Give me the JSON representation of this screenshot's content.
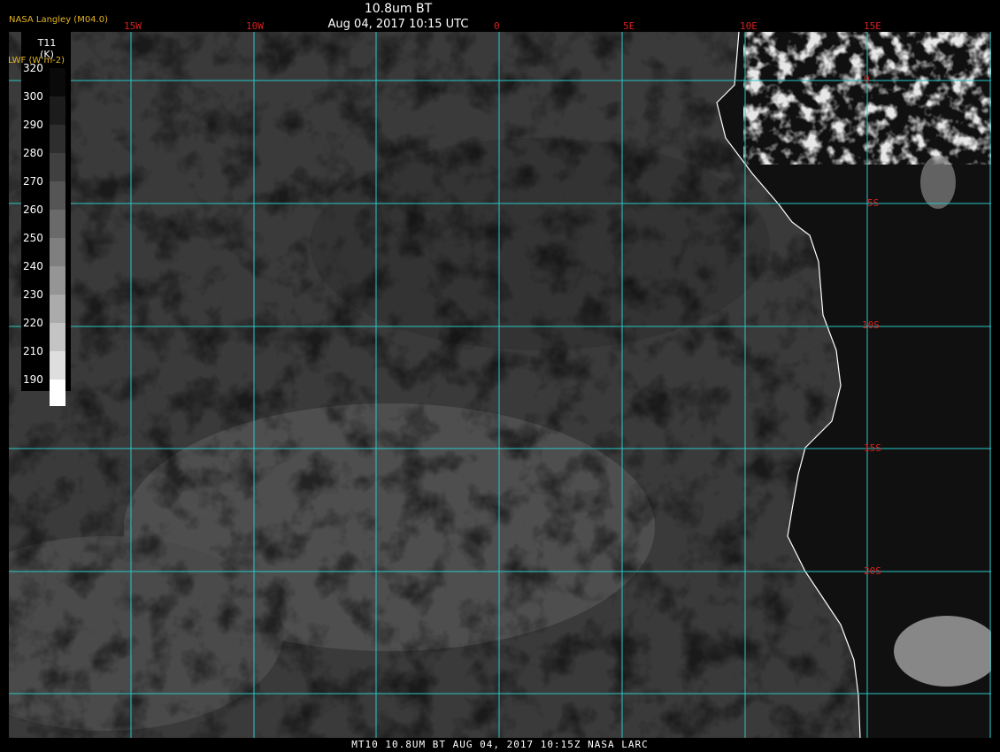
{
  "header": {
    "agency": "NASA Langley (M04.0)",
    "title": "10.8um BT",
    "timestamp": "Aug 04, 2017 10:15 UTC"
  },
  "legend": {
    "variable": "T11",
    "unit": "(K)",
    "name": "LWF (W m-2)",
    "ticks": [
      "320",
      "300",
      "290",
      "280",
      "270",
      "260",
      "250",
      "240",
      "230",
      "220",
      "210",
      "190"
    ],
    "colors": [
      "#0a0a0a",
      "#1c1c1c",
      "#2e2e2e",
      "#404040",
      "#555555",
      "#6a6a6a",
      "#7f7f7f",
      "#959595",
      "#ababab",
      "#c4c4c4",
      "#dedede",
      "#ffffff"
    ]
  },
  "grid": {
    "color": "#28c8c8",
    "lon_labels": [
      "15W",
      "10W",
      "0",
      "5E",
      "10E",
      "15E"
    ],
    "lat_labels": [
      "0",
      "5S",
      "10S",
      "15S",
      "20S"
    ]
  },
  "footer": "MT10   10.8UM BT   AUG 04, 2017 10:15Z   NASA LARC",
  "colors": {
    "ocean": "#3a3a3a",
    "land": "#101010",
    "coastline": "#ffffff",
    "label": "#d42020"
  }
}
